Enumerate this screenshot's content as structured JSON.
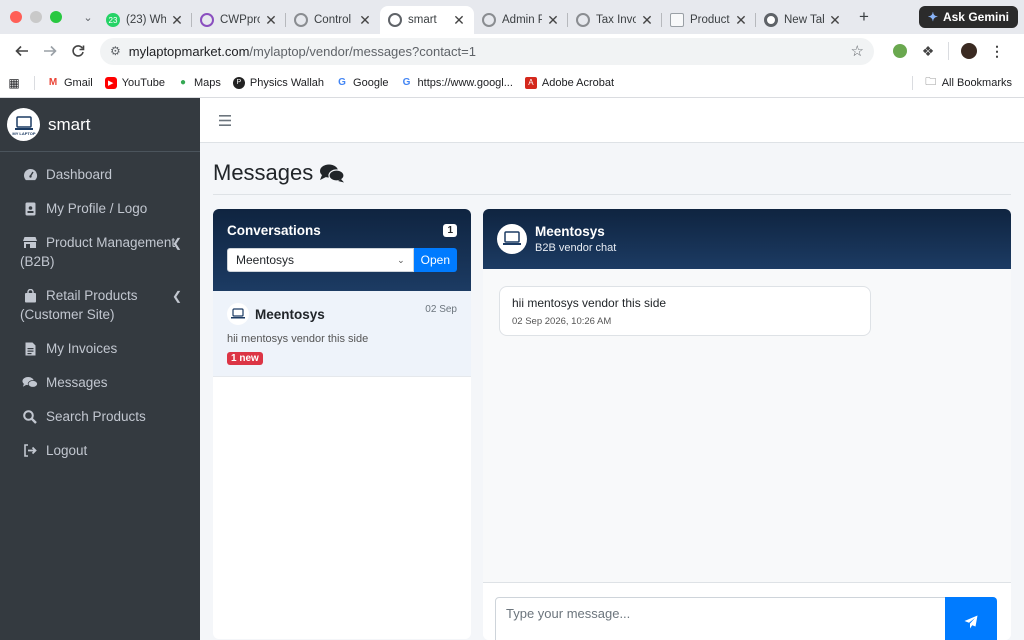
{
  "browser": {
    "tabs": [
      {
        "label": "(23) Wh"
      },
      {
        "label": "CWPpro"
      },
      {
        "label": "Control"
      },
      {
        "label": "smart"
      },
      {
        "label": "Admin P"
      },
      {
        "label": "Tax Invo"
      },
      {
        "label": "Product"
      },
      {
        "label": "New Tab"
      }
    ],
    "new_tab": "+",
    "ask_gemini": "Ask Gemini",
    "url_host": "mylaptopmarket.com",
    "url_path": "/mylaptop/vendor/messages?contact=1",
    "bookmarks": [
      {
        "label": "Gmail"
      },
      {
        "label": "YouTube"
      },
      {
        "label": "Maps"
      },
      {
        "label": "Physics Wallah"
      },
      {
        "label": "Google"
      },
      {
        "label": "https://www.googl..."
      },
      {
        "label": "Adobe Acrobat"
      }
    ],
    "all_bookmarks": "All Bookmarks"
  },
  "sidebar": {
    "brand": "smart",
    "items": [
      {
        "label": "Dashboard"
      },
      {
        "label": "My Profile / Logo"
      },
      {
        "label_line1": "Product Management",
        "label_line2": "(B2B)"
      },
      {
        "label_line1": "Retail Products",
        "label_line2": "(Customer Site)"
      },
      {
        "label": "My Invoices"
      },
      {
        "label": "Messages"
      },
      {
        "label": "Search Products"
      },
      {
        "label": "Logout"
      }
    ]
  },
  "page": {
    "title": "Messages"
  },
  "conversations": {
    "title": "Conversations",
    "count": "1",
    "select_value": "Meentosys",
    "open_label": "Open",
    "items": [
      {
        "name": "Meentosys",
        "date": "02 Sep",
        "preview": "hii mentosys vendor this side",
        "badge": "1 new"
      }
    ]
  },
  "chat": {
    "name": "Meentosys",
    "subtitle": "B2B vendor chat",
    "messages": [
      {
        "text": "hii mentosys vendor this side",
        "time": "02 Sep 2026, 10:26 AM"
      }
    ],
    "input_placeholder": "Type your message..."
  },
  "colors": {
    "sidebar_bg": "#343a40",
    "header_gradient": "#0f2440",
    "primary": "#007bff",
    "danger": "#dc3545"
  }
}
